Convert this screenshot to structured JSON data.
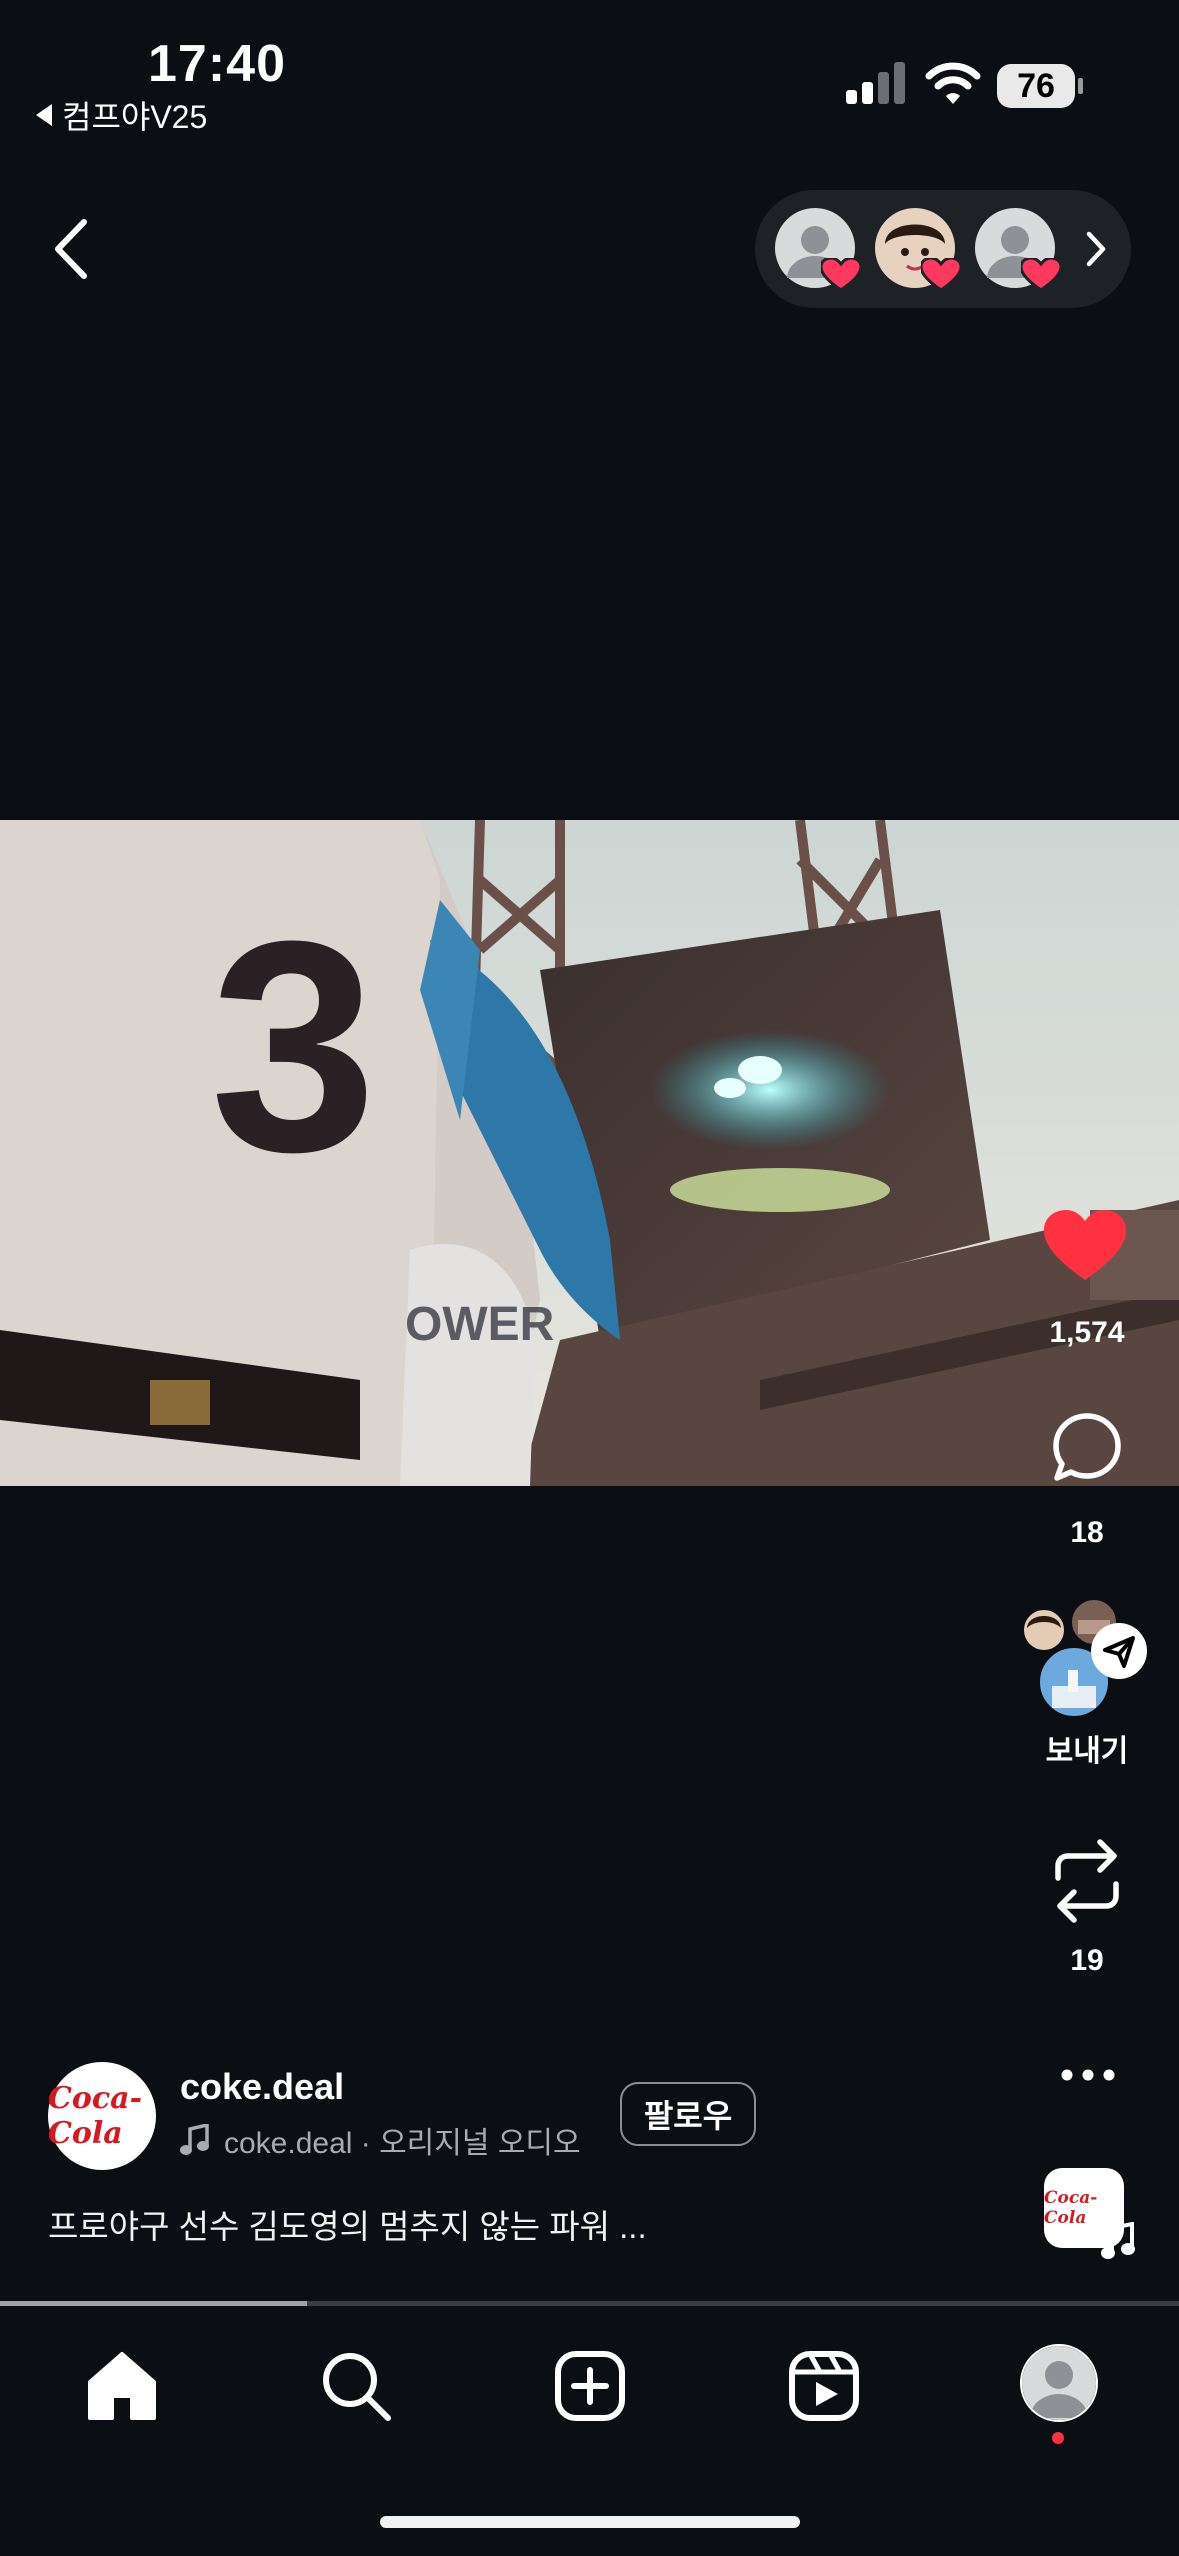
{
  "status_bar": {
    "time": "17:40",
    "back_app": "컴프야V25",
    "battery": "76"
  },
  "reel": {
    "likes": "1,574",
    "comments": "18",
    "send_label": "보내기",
    "reposts": "19",
    "author": {
      "username": "coke.deal",
      "avatar_text": "Coca-Cola",
      "audio": "coke.deal · 오리지널 오디오",
      "follow_label": "팔로우"
    },
    "caption": "프로야구 선수 김도영의 멈추지 않는 파워 ...",
    "video": {
      "jersey_number": "3",
      "jersey_text": "POWERADE"
    },
    "progress": 0.26,
    "music_thumb_text": "Coca-Cola"
  },
  "colors": {
    "background": "#0b0e13",
    "like_red": "#ff3040",
    "notification_dot": "#ff3040"
  },
  "icons": {
    "back": "chevron-left-icon",
    "likers_more": "chevron-right-icon",
    "like": "heart-icon",
    "comment": "comment-icon",
    "send": "paper-plane-icon",
    "repost": "repost-icon",
    "more": "more-icon",
    "tabs": [
      "home-icon",
      "search-icon",
      "create-icon",
      "reels-icon",
      "profile-icon"
    ]
  }
}
